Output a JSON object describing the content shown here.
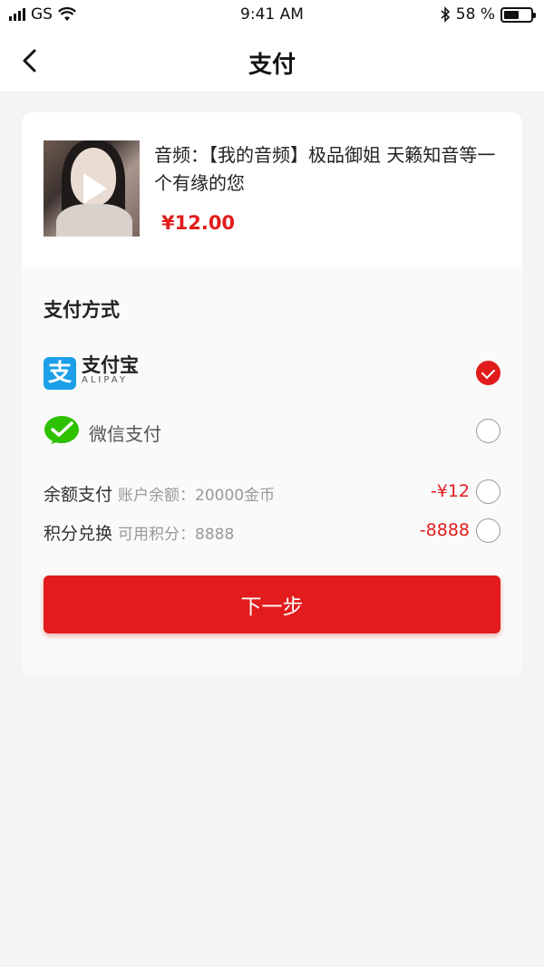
{
  "status_bar": {
    "carrier": "GS",
    "time": "9:41 AM",
    "battery_percent": "58 %",
    "battery_level": 0.58
  },
  "nav": {
    "title": "支付"
  },
  "product": {
    "title": "音频：【我的音频】极品御姐 天籁知音等一个有缘的您",
    "price": "¥12.00"
  },
  "payment": {
    "section_title": "支付方式",
    "methods": [
      {
        "id": "alipay",
        "label_cn": "支付宝",
        "label_en": "ALIPAY",
        "selected": true
      },
      {
        "id": "wechat",
        "label": "微信支付",
        "selected": false
      }
    ],
    "balance": {
      "label": "余额支付",
      "sub": "账户余额：20000金币",
      "amount": "-¥12",
      "selected": false
    },
    "points": {
      "label": "积分兑换",
      "sub": "可用积分：8888",
      "amount": "-8888",
      "selected": false
    }
  },
  "actions": {
    "next_label": "下一步"
  },
  "colors": {
    "accent": "#e21c1c",
    "alipay_blue": "#1b9fe8",
    "wechat_green": "#2dc100"
  }
}
